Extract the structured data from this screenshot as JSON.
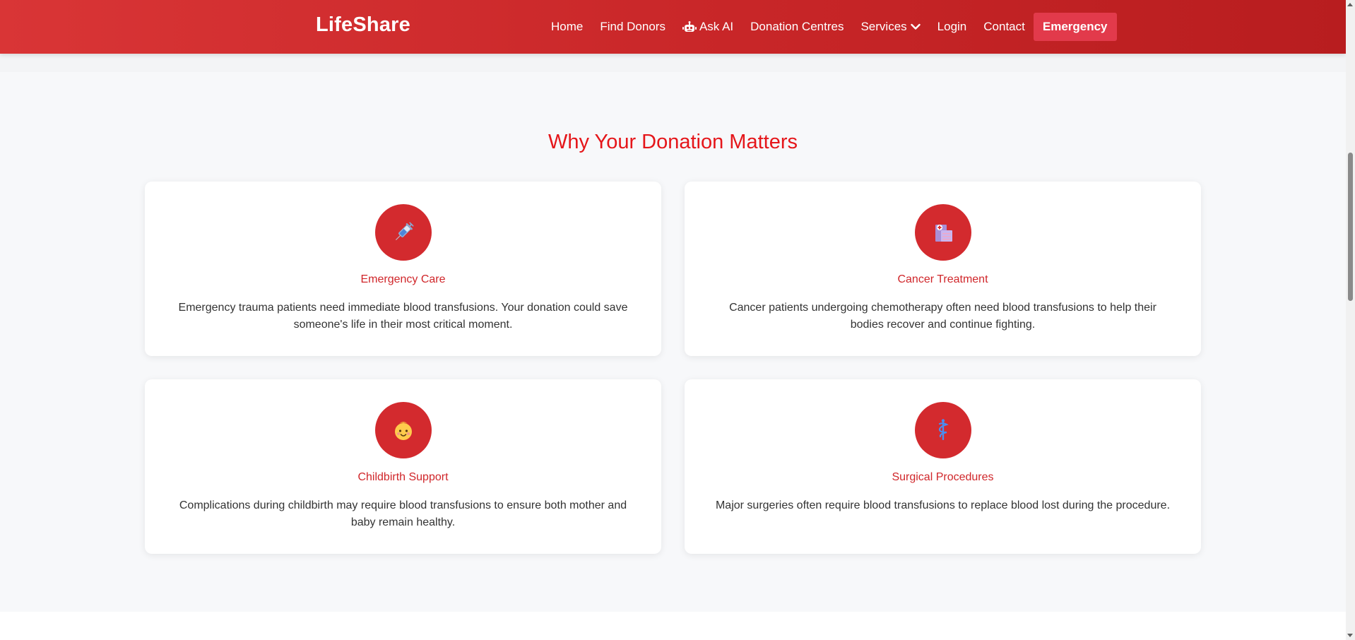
{
  "navbar": {
    "brand": "LifeShare",
    "items": [
      {
        "label": "Home"
      },
      {
        "label": "Find Donors"
      },
      {
        "label": "Ask AI",
        "icon": "robot-icon"
      },
      {
        "label": "Donation Centres"
      },
      {
        "label": "Services",
        "icon": "chevron-down-icon"
      },
      {
        "label": "Login"
      },
      {
        "label": "Contact"
      }
    ],
    "emergency_label": "Emergency"
  },
  "section": {
    "title": "Why Your Donation Matters",
    "cards": [
      {
        "icon": "syringe-icon",
        "title": "Emergency Care",
        "text": "Emergency trauma patients need immediate blood transfusions. Your donation could save someone's life in their most critical moment."
      },
      {
        "icon": "hospital-icon",
        "title": "Cancer Treatment",
        "text": "Cancer patients undergoing chemotherapy often need blood transfusions to help their bodies recover and continue fighting."
      },
      {
        "icon": "baby-icon",
        "title": "Childbirth Support",
        "text": "Complications during childbirth may require blood transfusions to ensure both mother and baby remain healthy."
      },
      {
        "icon": "medical-symbol-icon",
        "title": "Surgical Procedures",
        "text": "Major surgeries often require blood transfusions to replace blood lost during the procedure."
      }
    ]
  },
  "colors": {
    "brand_red": "#d32a2e",
    "title_red": "#e5161a",
    "emergency_button": "#e23a4b",
    "section_background": "#f7f8fa"
  }
}
